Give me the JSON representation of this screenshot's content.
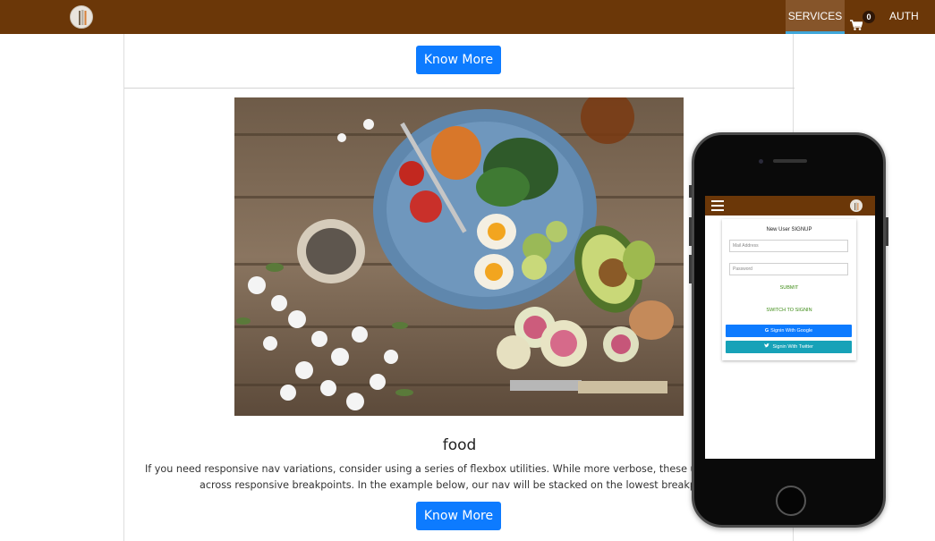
{
  "navbar": {
    "services_label": "SERVICES",
    "cart_count": "0",
    "auth_label": "AUTH",
    "accent_color": "#6b3708",
    "active_indicator_color": "#3fa6d9"
  },
  "cards": {
    "top": {
      "button_label": "Know More"
    },
    "food": {
      "title": "food",
      "text_line1": "If you need responsive nav variations, consider using a series of flexbox utilities. While more verbose, these utilities offer gre",
      "text_line2": "across responsive breakpoints. In the example below, our nav will be stacked on the lowest breakpoint,",
      "button_label": "Know More"
    }
  },
  "phone": {
    "signup": {
      "title": "New User SIGNUP",
      "email_placeholder": "Mail Address",
      "password_placeholder": "Password",
      "submit_label": "SUBMIT",
      "switch_label": "SWITCH TO SIGNIN",
      "google_label": "Signin With Google",
      "twitter_label": "Signin With Twitter"
    }
  }
}
